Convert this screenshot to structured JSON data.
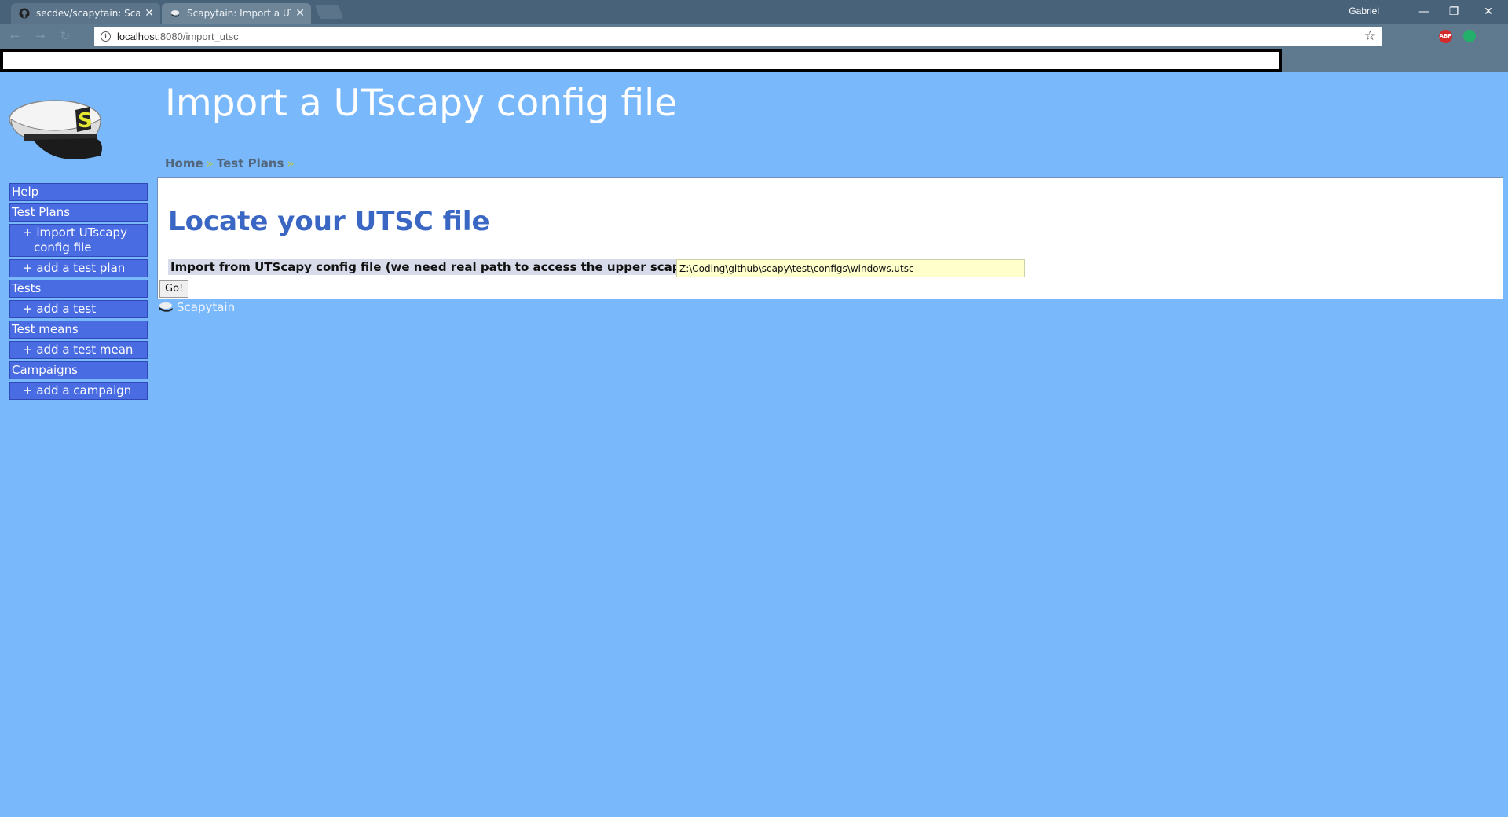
{
  "browser": {
    "tabs": [
      {
        "title": "secdev/scapytain: Scapyt",
        "active": false
      },
      {
        "title": "Scapytain: Import a UTsc",
        "active": true
      }
    ],
    "profile_name": "Gabriel",
    "url_host": "localhost",
    "url_path": ":8080/import_utsc",
    "extension_abp_label": "ABP"
  },
  "page": {
    "title": "Import a UTscapy config file",
    "breadcrumb": [
      {
        "label": "Home"
      },
      {
        "label": "Test Plans"
      }
    ],
    "breadcrumb_separator": "»"
  },
  "sidebar": {
    "items": [
      {
        "label": "Help",
        "sub": false
      },
      {
        "label": "Test Plans",
        "sub": false
      },
      {
        "label": "+ import UTscapy",
        "label2": "config file",
        "sub": true
      },
      {
        "label": "+ add a test plan",
        "sub": true
      },
      {
        "label": "Tests",
        "sub": false
      },
      {
        "label": "+ add a test",
        "sub": true
      },
      {
        "label": "Test means",
        "sub": false
      },
      {
        "label": "+ add a test mean",
        "sub": true
      },
      {
        "label": "Campaigns",
        "sub": false
      },
      {
        "label": "+ add a campaign",
        "sub": true
      }
    ]
  },
  "main": {
    "section_title": "Locate your UTSC file",
    "form_label": "Import from UTScapy config file (we need real path to access the upper scapy folder)",
    "path_value": "Z:\\Coding\\github\\scapy\\test\\configs\\windows.utsc",
    "go_label": "Go!"
  },
  "footer": {
    "label": "Scapytain"
  },
  "colors": {
    "page_bg": "#79b8fb",
    "menu_bg": "#4a6ce3",
    "section_title": "#3a66c4",
    "input_bg": "#ffffcc"
  }
}
